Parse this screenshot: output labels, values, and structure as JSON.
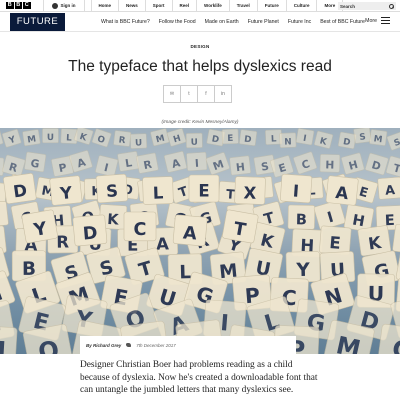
{
  "brand": {
    "letters": [
      "B",
      "B",
      "C"
    ]
  },
  "topbar": {
    "signin_label": "Sign in",
    "nav": [
      "Home",
      "News",
      "Sport",
      "Reel",
      "Worklife",
      "Travel",
      "Future",
      "Culture",
      "More"
    ],
    "search_label": "Search"
  },
  "section": {
    "logo": "FUTURE",
    "nav": [
      "What is BBC Future?",
      "Follow the Food",
      "Made on Earth",
      "Future Planet",
      "Future Inc",
      "Best of BBC Future"
    ],
    "more_label": "More"
  },
  "article": {
    "category": "DESIGN",
    "headline": "The typeface that helps dyslexics read",
    "share_icons": [
      "email-icon",
      "twitter-icon",
      "facebook-icon",
      "linkedin-icon"
    ],
    "share_glyphs": [
      "✉",
      "t",
      "f",
      "in"
    ],
    "image_credit": "(Image credit: Kevin Mesney/Alamy)",
    "tiles": {
      "row1": [
        "D",
        "Y",
        "S",
        "L",
        "E",
        "X",
        "I",
        "A"
      ],
      "row2": [
        "Y",
        "D",
        "C",
        "A",
        "T"
      ]
    },
    "byline": {
      "author": "By Richard Grey",
      "date": "7th December 2017"
    },
    "intro": "Designer Christian Boer had problems reading as a child because of dyslexia. Now he's created a downloadable font that can untangle the jumbled letters that many dyslexics see."
  },
  "colors": {
    "future_navy": "#0a1a3a",
    "tile": "#efe6cf",
    "tile_letter": "#2a3550"
  }
}
